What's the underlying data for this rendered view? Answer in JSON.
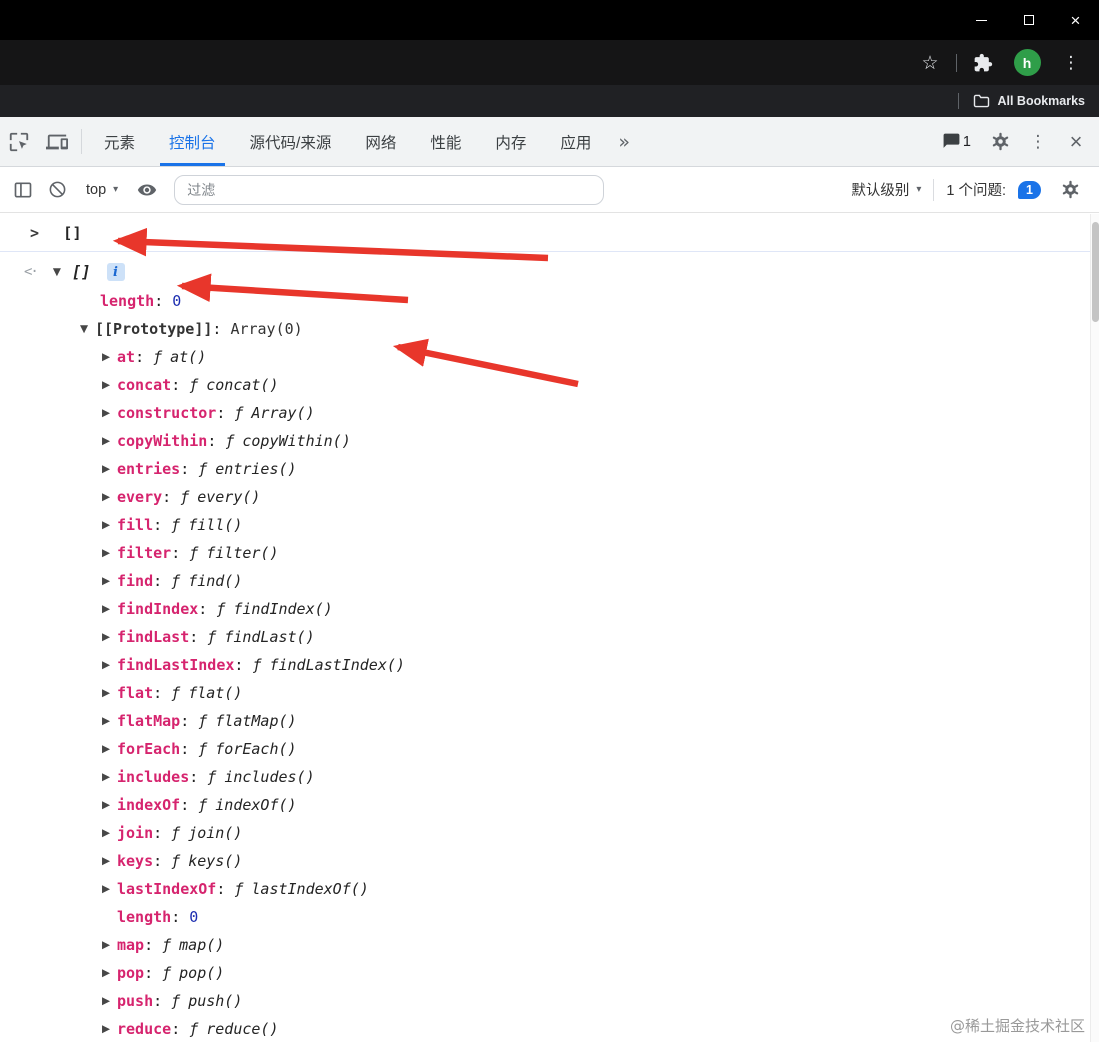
{
  "titlebar": {},
  "browser_toolbar": {
    "avatar_letter": "h"
  },
  "bookmarks_bar": {
    "all_bookmarks": "All Bookmarks"
  },
  "devtools_tabs": {
    "tabs": [
      "元素",
      "控制台",
      "源代码/来源",
      "网络",
      "性能",
      "内存",
      "应用"
    ],
    "active_tab": "控制台",
    "messages_count": "1"
  },
  "console_toolbar": {
    "context": "top",
    "filter_placeholder": "过滤",
    "levels_label": "默认级别",
    "issues_label": "1 个问题:",
    "issues_count": "1"
  },
  "console": {
    "echo_value": "[]",
    "result_value": "[]",
    "info_badge": "i",
    "length_name": "length",
    "length_value": "0",
    "prototype_name": "[[Prototype]]",
    "prototype_value": "Array(0)",
    "fn": "ƒ",
    "colon": ":",
    "properties": [
      {
        "name": "at",
        "type": "function",
        "value": "at()"
      },
      {
        "name": "concat",
        "type": "function",
        "value": "concat()"
      },
      {
        "name": "constructor",
        "type": "function",
        "value": "Array()"
      },
      {
        "name": "copyWithin",
        "type": "function",
        "value": "copyWithin()"
      },
      {
        "name": "entries",
        "type": "function",
        "value": "entries()"
      },
      {
        "name": "every",
        "type": "function",
        "value": "every()"
      },
      {
        "name": "fill",
        "type": "function",
        "value": "fill()"
      },
      {
        "name": "filter",
        "type": "function",
        "value": "filter()"
      },
      {
        "name": "find",
        "type": "function",
        "value": "find()"
      },
      {
        "name": "findIndex",
        "type": "function",
        "value": "findIndex()"
      },
      {
        "name": "findLast",
        "type": "function",
        "value": "findLast()"
      },
      {
        "name": "findLastIndex",
        "type": "function",
        "value": "findLastIndex()"
      },
      {
        "name": "flat",
        "type": "function",
        "value": "flat()"
      },
      {
        "name": "flatMap",
        "type": "function",
        "value": "flatMap()"
      },
      {
        "name": "forEach",
        "type": "function",
        "value": "forEach()"
      },
      {
        "name": "includes",
        "type": "function",
        "value": "includes()"
      },
      {
        "name": "indexOf",
        "type": "function",
        "value": "indexOf()"
      },
      {
        "name": "join",
        "type": "function",
        "value": "join()"
      },
      {
        "name": "keys",
        "type": "function",
        "value": "keys()"
      },
      {
        "name": "lastIndexOf",
        "type": "function",
        "value": "lastIndexOf()"
      },
      {
        "name": "length",
        "type": "number",
        "value": "0"
      },
      {
        "name": "map",
        "type": "function",
        "value": "map()"
      },
      {
        "name": "pop",
        "type": "function",
        "value": "pop()"
      },
      {
        "name": "push",
        "type": "function",
        "value": "push()"
      },
      {
        "name": "reduce",
        "type": "function",
        "value": "reduce()"
      }
    ]
  },
  "icons": {
    "minimize": "—",
    "close": "×",
    "star": "☆",
    "kebab": "⋮",
    "more_tabs": "»",
    "caret_down": "▾",
    "input_chevron": ">",
    "result_marker": "<·",
    "expander_open": "▼",
    "expander_closed": "▶"
  },
  "watermark": "@稀土掘金技术社区",
  "colors": {
    "accent_blue": "#1a73e8",
    "property_name_pink": "#d6246e",
    "number_blue": "#1c2db0",
    "arrow_red": "#e8362b"
  }
}
